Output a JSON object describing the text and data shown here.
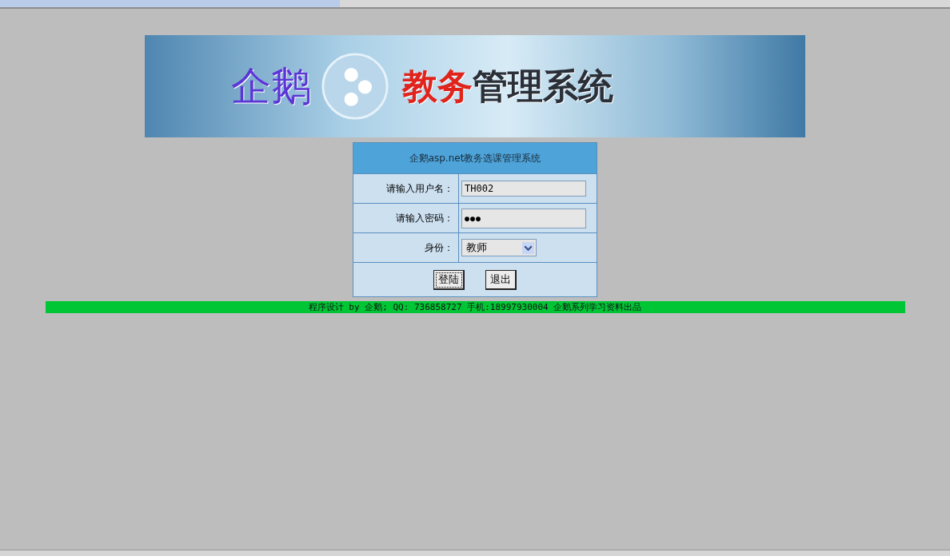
{
  "banner": {
    "brand": "企鹅",
    "title_accent": "教务",
    "title_rest": "管理系统"
  },
  "login": {
    "title": "企鹅asp.net教务选课管理系统",
    "username": {
      "label": "请输入用户名：",
      "value": "TH002"
    },
    "password": {
      "label": "请输入密码：",
      "value": "●●●"
    },
    "role": {
      "label": "身份：",
      "value": "教师"
    },
    "buttons": [
      "登陆",
      "退出"
    ]
  },
  "footer": "程序设计 by 企鹅; QQ: 736858727 手机:18997930004 企鹅系列学习资料出品"
}
